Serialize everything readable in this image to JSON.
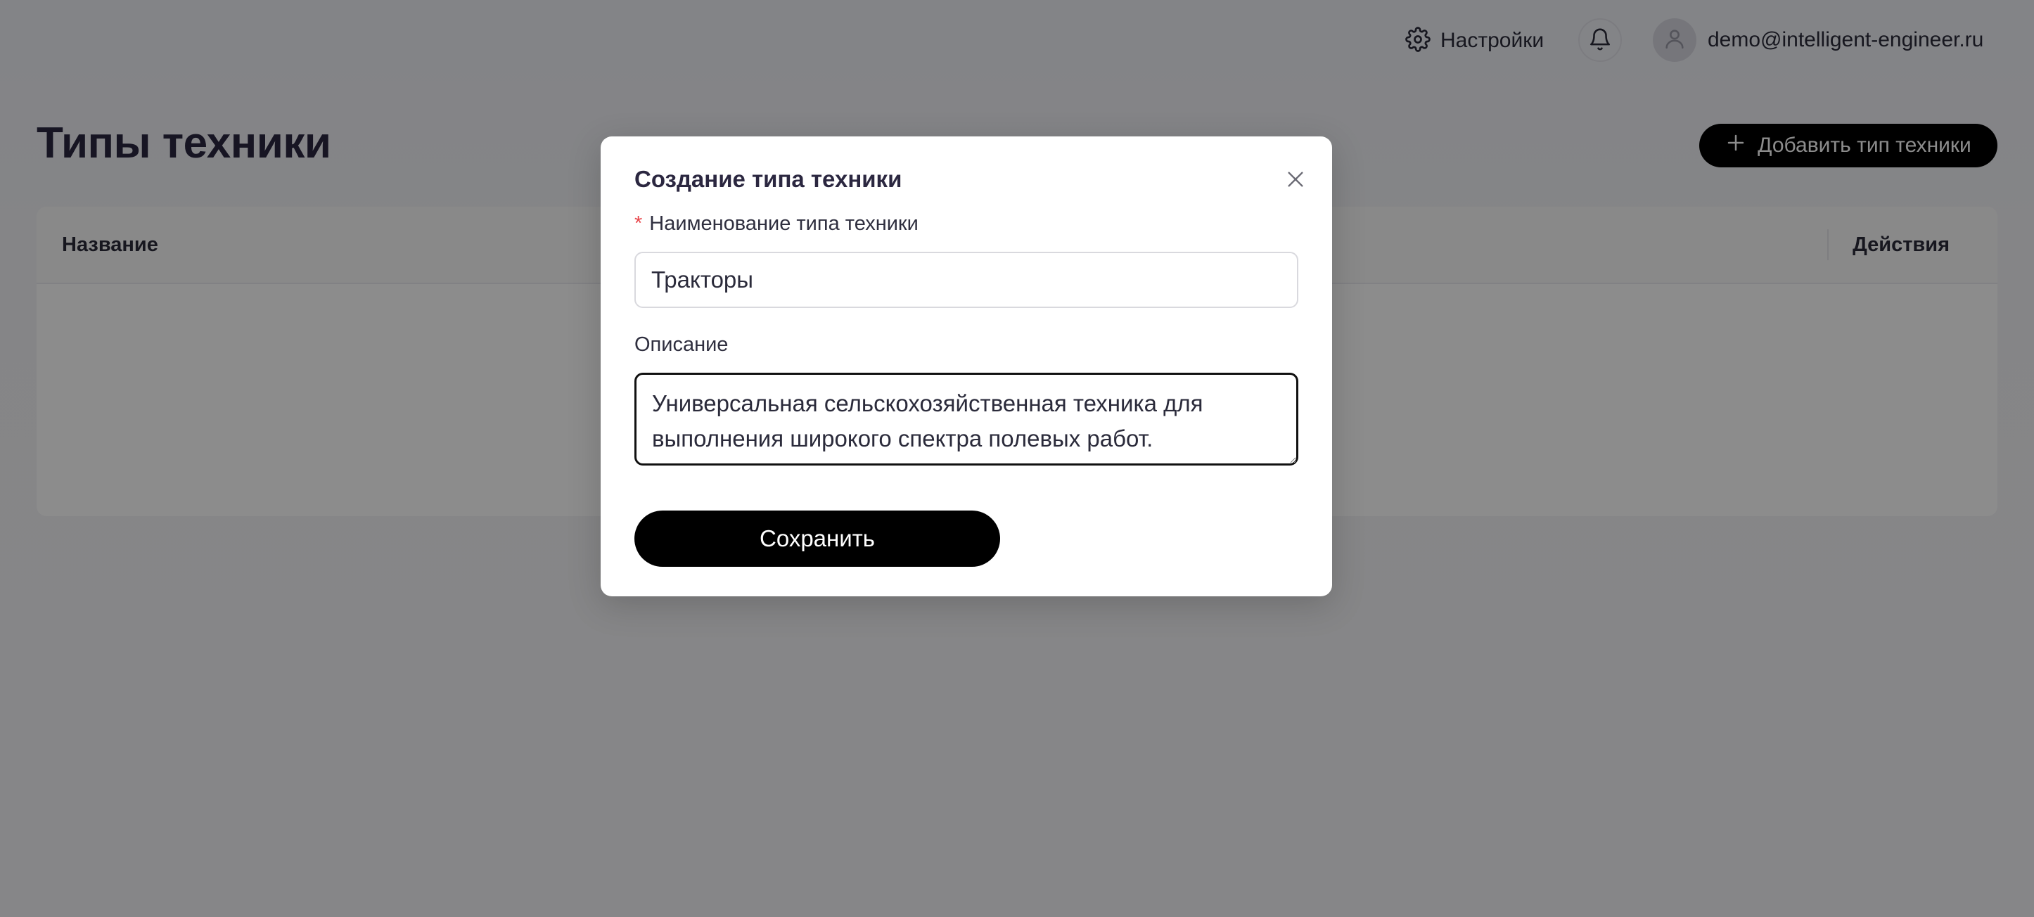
{
  "header": {
    "settings_label": "Настройки",
    "user_email": "demo@intelligent-engineer.ru"
  },
  "page": {
    "title": "Типы техники",
    "add_button_label": "Добавить тип техники"
  },
  "table": {
    "columns": [
      "Название",
      "Действия"
    ]
  },
  "modal": {
    "title": "Создание типа техники",
    "name_field": {
      "label": "Наименование типа техники",
      "required_mark": "*",
      "value": "Тракторы"
    },
    "description_field": {
      "label": "Описание",
      "value": "Универсальная сельскохозяйственная техника для выполнения широкого спектра полевых работ."
    },
    "save_label": "Сохранить"
  },
  "colors": {
    "primary_button": "#000000",
    "required_mark": "#e8474c",
    "overlay": "rgba(0,0,0,0.45)"
  },
  "icons": {
    "settings": "gear-icon",
    "notifications": "bell-icon",
    "user": "user-icon",
    "add": "plus-icon",
    "close": "close-icon"
  }
}
